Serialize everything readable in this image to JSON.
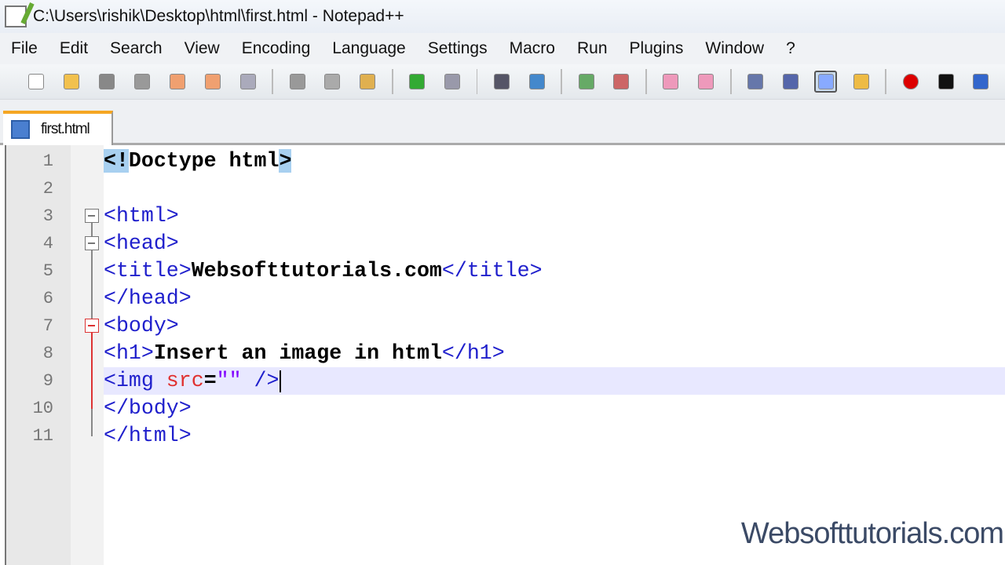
{
  "window": {
    "title": "C:\\Users\\rishik\\Desktop\\html\\first.html - Notepad++"
  },
  "menu": [
    "File",
    "Edit",
    "Search",
    "View",
    "Encoding",
    "Language",
    "Settings",
    "Macro",
    "Run",
    "Plugins",
    "Window",
    "?"
  ],
  "toolbar": [
    "new-file",
    "open-file",
    "save",
    "save-all",
    "close",
    "close-all",
    "print",
    "|",
    "cut",
    "copy",
    "paste",
    "|",
    "undo",
    "redo",
    "|",
    "find",
    "replace",
    "|",
    "zoom-in",
    "zoom-out",
    "|",
    "sync-vertical",
    "sync-horizontal",
    "|",
    "word-wrap",
    "show-all-chars",
    "indent-guide",
    "user-lang",
    "|",
    "record-macro",
    "stop-record",
    "play-macro"
  ],
  "tab": {
    "label": "first.html"
  },
  "editor": {
    "current_line": 9,
    "lines": [
      [
        [
          "doc",
          "<!",
          "hl"
        ],
        [
          "doc",
          "Doctype html"
        ],
        [
          "doc",
          ">",
          "hl"
        ]
      ],
      [],
      [
        [
          "tag",
          "<html>"
        ]
      ],
      [
        [
          "tag",
          "<head>"
        ]
      ],
      [
        [
          "tag",
          "<title>"
        ],
        [
          "text",
          "Websofttutorials.com"
        ],
        [
          "tag",
          "</title>"
        ]
      ],
      [
        [
          "tag",
          "</head>"
        ]
      ],
      [
        [
          "tag",
          "<body>"
        ]
      ],
      [
        [
          "tag",
          "<h1>"
        ],
        [
          "text",
          "Insert an image in html"
        ],
        [
          "tag",
          "</h1>"
        ]
      ],
      [
        [
          "tag",
          "<img "
        ],
        [
          "attr",
          "src"
        ],
        [
          "text",
          "="
        ],
        [
          "val",
          "\"\""
        ],
        [
          "tag",
          " />"
        ]
      ],
      [
        [
          "tag",
          "</body>"
        ]
      ],
      [
        [
          "tag",
          "</html>"
        ]
      ]
    ]
  },
  "watermark": "Websofttutorials.com"
}
